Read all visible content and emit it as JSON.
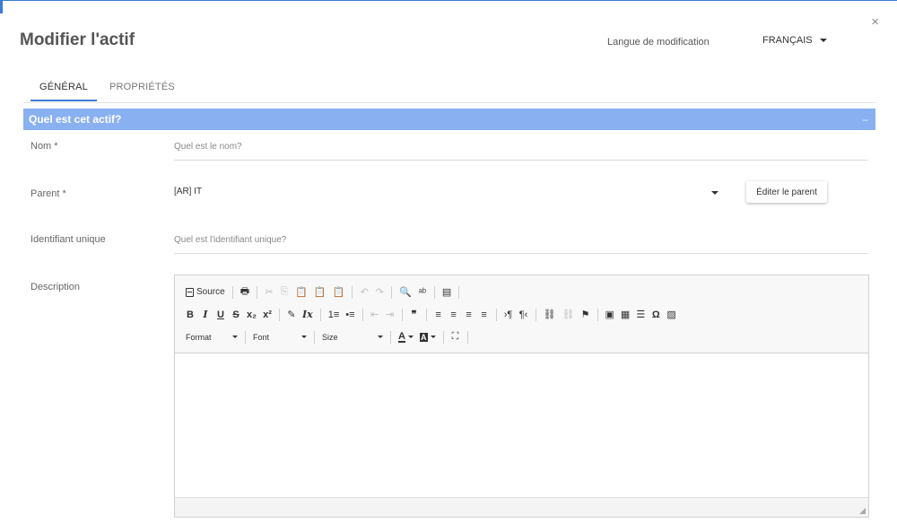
{
  "dialog": {
    "title": "Modifier l'actif",
    "close": "×",
    "lang_label": "Langue de modification",
    "lang_value": "FRANÇAIS"
  },
  "tabs": [
    {
      "label": "GÉNÉRAL",
      "active": true
    },
    {
      "label": "PROPRIÉTÉS",
      "active": false
    }
  ],
  "section": {
    "title": "Quel est cet actif?",
    "collapse": "–"
  },
  "form": {
    "name_label": "Nom *",
    "name_placeholder": "Quel est le nom?",
    "parent_label": "Parent *",
    "parent_value": "[AR] IT",
    "edit_parent": "Éditer le parent",
    "uid_label": "Identifiant unique",
    "uid_placeholder": "Quel est l'identifiant unique?",
    "desc_label": "Description"
  },
  "editor": {
    "source": "Source",
    "format": "Format",
    "font": "Font",
    "size": "Size",
    "icons": {
      "print": "🖶",
      "cut": "✂",
      "copy": "⎘",
      "paste": "📋",
      "undo": "↶",
      "redo": "↷",
      "find": "🔍",
      "replace": "⇆"
    },
    "glyphs": {
      "bold": "B",
      "italic": "I",
      "underline": "U",
      "strike": "S",
      "subscript": "x₂",
      "superscript": "x²",
      "remove_format": "Ix",
      "quote": "❞",
      "ol": "1≡",
      "ul": "•≡",
      "outdent": "⇤",
      "indent": "⇥",
      "align_left": "≡",
      "align_center": "≡",
      "align_right": "≡",
      "justify": "≡",
      "ltr": "›¶",
      "rtl": "¶‹",
      "link": "⛓",
      "unlink": "⛓",
      "anchor": "⚑",
      "flash": "▣",
      "table": "▦",
      "hr": "☰",
      "omega": "Ω",
      "image": "▨",
      "text_color": "A",
      "bg_color": "A",
      "maximize": "⛶",
      "copyformat": "✎",
      "template": "▤",
      "spell": "ᵃᵇ"
    }
  },
  "colors": {
    "accent": "#3a7bd5",
    "section_bg": "#89b0f1"
  }
}
